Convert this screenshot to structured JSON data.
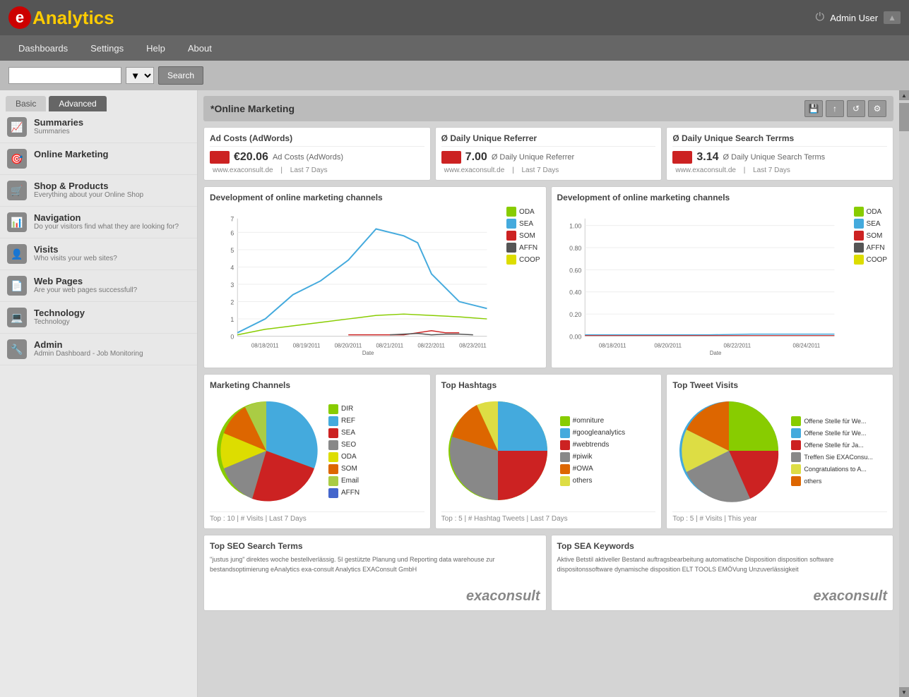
{
  "header": {
    "logo_e": "e",
    "logo_text_analytics": "Analytics",
    "admin_user": "Admin User"
  },
  "nav": {
    "items": [
      {
        "label": "Dashboards",
        "id": "dashboards"
      },
      {
        "label": "Settings",
        "id": "settings"
      },
      {
        "label": "Help",
        "id": "help"
      },
      {
        "label": "About",
        "id": "about"
      }
    ]
  },
  "search": {
    "placeholder": "",
    "button_label": "Search"
  },
  "sidebar": {
    "tab_basic": "Basic",
    "tab_advanced": "Advanced",
    "items": [
      {
        "id": "summaries",
        "label": "Summaries",
        "sub": "Summaries",
        "icon": "📈"
      },
      {
        "id": "online-marketing",
        "label": "Online Marketing",
        "sub": "",
        "icon": "🎯"
      },
      {
        "id": "shop-products",
        "label": "Shop & Products",
        "sub": "Everything about your Online Shop",
        "icon": "🛒"
      },
      {
        "id": "navigation",
        "label": "Navigation",
        "sub": "Do your visitors find what they are looking for?",
        "icon": "📊"
      },
      {
        "id": "visits",
        "label": "Visits",
        "sub": "Who visits your web sites?",
        "icon": "👤"
      },
      {
        "id": "web-pages",
        "label": "Web Pages",
        "sub": "Are your web pages successfull?",
        "icon": "📄"
      },
      {
        "id": "technology",
        "label": "Technology",
        "sub": "Technology",
        "icon": "💻"
      },
      {
        "id": "admin",
        "label": "Admin",
        "sub": "Admin Dashboard - Job Monitoring",
        "icon": "🔧"
      }
    ]
  },
  "content": {
    "page_title": "*Online Marketing",
    "kpi_cards": [
      {
        "title": "Ad Costs (AdWords)",
        "color": "#cc2222",
        "value": "€20.06",
        "label": "Ad Costs (AdWords)",
        "site": "www.exaconsult.de",
        "period": "Last 7 Days"
      },
      {
        "title": "Ø Daily Unique Referrer",
        "color": "#cc2222",
        "value": "7.00",
        "label": "Ø Daily Unique Referrer",
        "site": "www.exaconsult.de",
        "period": "Last 7 Days"
      },
      {
        "title": "Ø Daily Unique Search Terrms",
        "color": "#cc2222",
        "value": "3.14",
        "label": "Ø Daily Unique Search Terms",
        "site": "www.exaconsult.de",
        "period": "Last 7 Days"
      }
    ],
    "line_charts": {
      "title": "Development of online marketing channels",
      "legend": [
        {
          "label": "ODA",
          "color": "#88cc00"
        },
        {
          "label": "SEA",
          "color": "#44aadd"
        },
        {
          "label": "SOM",
          "color": "#cc2222"
        },
        {
          "label": "AFFN",
          "color": "#555555"
        },
        {
          "label": "COOP",
          "color": "#dddd00"
        }
      ],
      "x_labels": [
        "08/18/2011",
        "08/19/2011",
        "08/20/2011",
        "08/21/2011",
        "08/22/2011",
        "08/23/2011",
        "08/24/2011"
      ],
      "y_labels": [
        "0",
        "1",
        "2",
        "3",
        "4",
        "5",
        "6",
        "7"
      ]
    },
    "line_chart2": {
      "title": "Development of online marketing channels",
      "y_labels": [
        "0.00",
        "0.20",
        "0.40",
        "0.60",
        "0.80",
        "1.00"
      ]
    },
    "marketing_channels": {
      "title": "Marketing Channels",
      "legend": [
        {
          "label": "DIR",
          "color": "#88cc00"
        },
        {
          "label": "REF",
          "color": "#44aadd"
        },
        {
          "label": "SEA",
          "color": "#cc2222"
        },
        {
          "label": "SEO",
          "color": "#888888"
        },
        {
          "label": "ODA",
          "color": "#dddd00"
        },
        {
          "label": "SOM",
          "color": "#dd6600"
        },
        {
          "label": "Email",
          "color": "#aacc44"
        },
        {
          "label": "AFFN",
          "color": "#4466cc"
        }
      ],
      "footer": "Top : 10  |  # Visits  |  Last 7 Days"
    },
    "top_hashtags": {
      "title": "Top Hashtags",
      "legend": [
        {
          "label": "#omniture",
          "color": "#88cc00"
        },
        {
          "label": "#googleanalytics",
          "color": "#44aadd"
        },
        {
          "label": "#webtrends",
          "color": "#cc2222"
        },
        {
          "label": "#piwik",
          "color": "#888888"
        },
        {
          "label": "#OWA",
          "color": "#dd6600"
        },
        {
          "label": "others",
          "color": "#dddd44"
        }
      ],
      "footer": "Top : 5  |  # Hashtag Tweets  |  Last 7 Days"
    },
    "top_tweet_visits": {
      "title": "Top Tweet Visits",
      "legend": [
        {
          "label": "Offene Stelle für We...",
          "color": "#88cc00"
        },
        {
          "label": "Offene Stelle für We...",
          "color": "#44aadd"
        },
        {
          "label": "Offene Stelle für Ja...",
          "color": "#cc2222"
        },
        {
          "label": "Treffen Sie EXAConsu...",
          "color": "#888888"
        },
        {
          "label": "Congratulations to A...",
          "color": "#dddd44"
        },
        {
          "label": "others",
          "color": "#dd6600"
        }
      ],
      "footer": "Top : 5  |  # Visits  |  This year"
    },
    "seo_card": {
      "title": "Top SEO Search Terms",
      "content": "\"justus jung\" direktes woche bestellverlässig. 5I gestützte Planung und Reporting\ndata warehouse zur bestandsoptimierung  eAnalytics  exa-consult  Analytics  EXAConsult GmbH"
    },
    "sea_card": {
      "title": "Top SEA Keywords",
      "content": "Aktive Betstil  aktiveller Bestand  auftragsbearbeitung  automatische Disposition  disposition software  dispositonssoftware  dynamische disposition  ELT TOOLS  EMÖVung Unzuverlässigkeit"
    }
  }
}
